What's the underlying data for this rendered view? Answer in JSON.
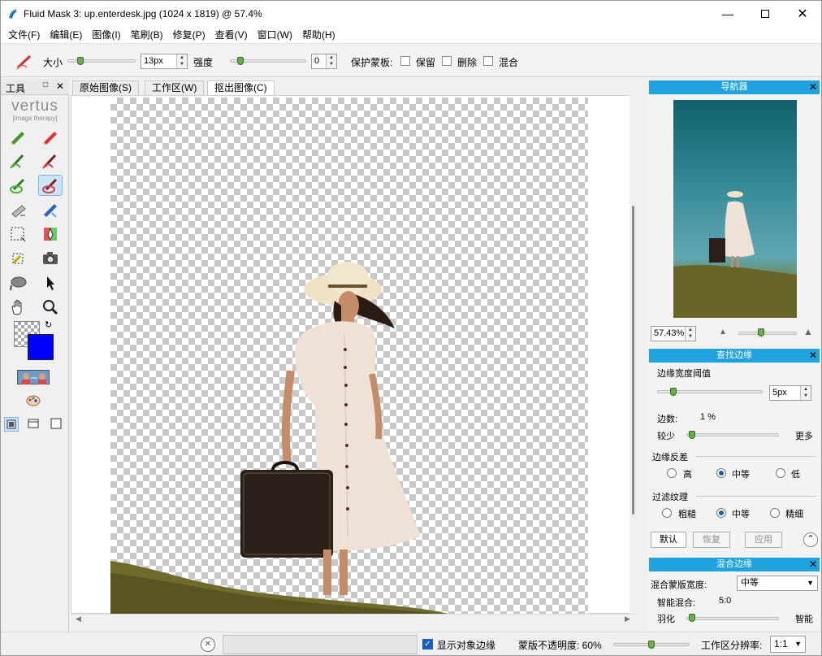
{
  "window": {
    "title": "Fluid Mask 3: up.enterdesk.jpg (1024 x 1819) @ 57.4%"
  },
  "menu": [
    "文件(F)",
    "编辑(E)",
    "图像(I)",
    "笔刷(B)",
    "修复(P)",
    "查看(V)",
    "窗口(W)",
    "帮助(H)"
  ],
  "toolbar": {
    "size_label": "大小",
    "size_value": "13px",
    "strength_label": "强度",
    "strength_value": "0",
    "protect_label": "保护蒙板:",
    "keep_label": "保留",
    "delete_label": "删除",
    "blend_label": "混合"
  },
  "tools_panel": {
    "title": "工具",
    "logo": "vertus",
    "logo_sub": "[image therapy]"
  },
  "tabs": [
    "原始图像(S)",
    "工作区(W)",
    "抠出图像(C)"
  ],
  "active_tab": "抠出图像(C)",
  "navigator": {
    "title": "导航器",
    "zoom_value": "57.43%"
  },
  "find_edges": {
    "title": "查找边缘",
    "width_label": "边缘宽度阈值",
    "width_value": "5px",
    "edges_label": "边数:",
    "edges_value": "1 %",
    "less_label": "较少",
    "more_label": "更多",
    "contrast_label": "边缘反差",
    "contrast_options": [
      "高",
      "中等",
      "低"
    ],
    "contrast_selected": "中等",
    "texture_label": "过滤纹理",
    "texture_options": [
      "粗糙",
      "中等",
      "精细"
    ],
    "texture_selected": "中等",
    "default_button": "默认",
    "restore_button": "恢复",
    "apply_button": "应用"
  },
  "blend_edges": {
    "title": "混合边缘",
    "width_label": "混合蒙版宽度:",
    "width_value": "中等",
    "smart_label": "智能混合:",
    "smart_value": "5:0",
    "feather_label": "羽化",
    "smart_end_label": "智能"
  },
  "status": {
    "show_edges_label": "显示对象边缘",
    "opacity_label": "蒙版不透明度: 60%",
    "resolution_label": "工作区分辨率:",
    "resolution_value": "1:1"
  },
  "colors": {
    "accent": "#1fa2e0",
    "foreground_swatch": "#0000ff"
  }
}
